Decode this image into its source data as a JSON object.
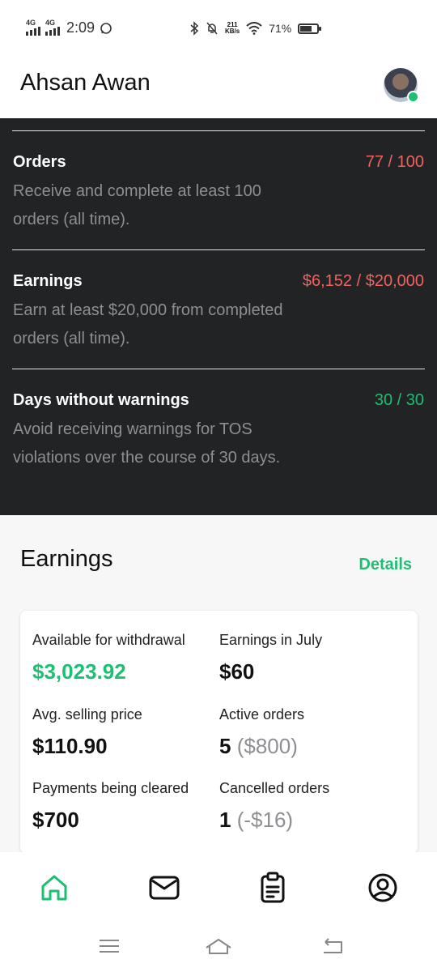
{
  "status_bar": {
    "network_1": "4G",
    "network_2": "4G",
    "time": "2:09",
    "net_speed_value": "211",
    "net_speed_unit": "KB/s",
    "battery": "71%",
    "battery_level": 0.71
  },
  "header": {
    "username": "Ahsan Awan",
    "online_status_color": "#1dbf73"
  },
  "requirements": [
    {
      "title": "Orders",
      "progress": "77 / 100",
      "description": "Receive and complete at least 100 orders (all time).",
      "status": "incomplete"
    },
    {
      "title": "Earnings",
      "progress": "$6,152 / $20,000",
      "description": "Earn at least $20,000 from completed orders (all time).",
      "status": "incomplete"
    },
    {
      "title": "Days without warnings",
      "progress": "30 / 30",
      "description": "Avoid receiving warnings for TOS violations over the course of 30 days.",
      "status": "complete"
    }
  ],
  "earnings": {
    "title": "Earnings",
    "details_label": "Details",
    "stats": {
      "available": {
        "label": "Available for withdrawal",
        "value": "$3,023.92"
      },
      "month": {
        "label": "Earnings in July",
        "value": "$60"
      },
      "avg_price": {
        "label": "Avg. selling price",
        "value": "$110.90"
      },
      "active": {
        "label": "Active orders",
        "value": "5",
        "extra": "($800)"
      },
      "clearing": {
        "label": "Payments being cleared",
        "value": "$700"
      },
      "cancelled": {
        "label": "Cancelled orders",
        "value": "1",
        "extra": "(-$16)"
      }
    }
  },
  "bottom_nav": [
    {
      "icon": "home-icon",
      "active": true
    },
    {
      "icon": "inbox-icon",
      "active": false
    },
    {
      "icon": "orders-icon",
      "active": false
    },
    {
      "icon": "profile-icon",
      "active": false
    }
  ],
  "colors": {
    "accent_green": "#1dbf73",
    "progress_red": "#f3625c",
    "dark_bg": "#222325"
  }
}
